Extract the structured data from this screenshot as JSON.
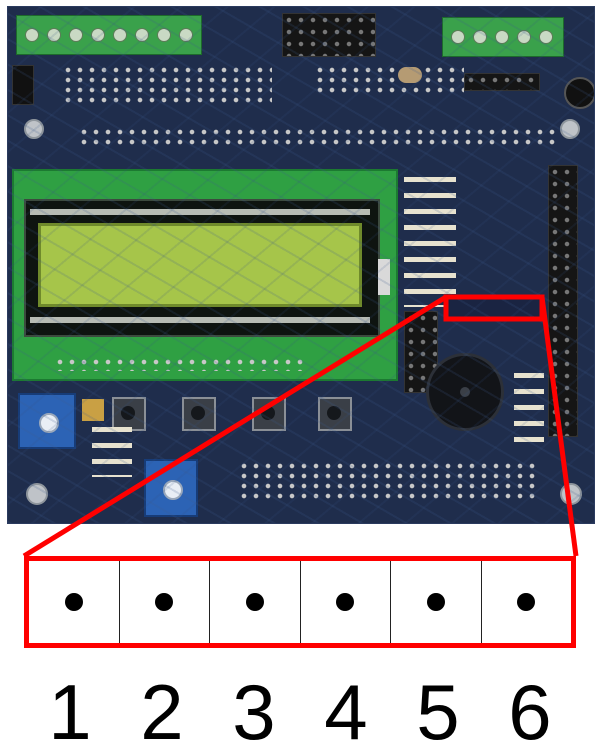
{
  "diagram": {
    "photo_description_icon": "pcb-board-photo",
    "callout_color": "#ff0000",
    "pins": [
      {
        "number": "1"
      },
      {
        "number": "2"
      },
      {
        "number": "3"
      },
      {
        "number": "4"
      },
      {
        "number": "5"
      },
      {
        "number": "6"
      }
    ]
  }
}
